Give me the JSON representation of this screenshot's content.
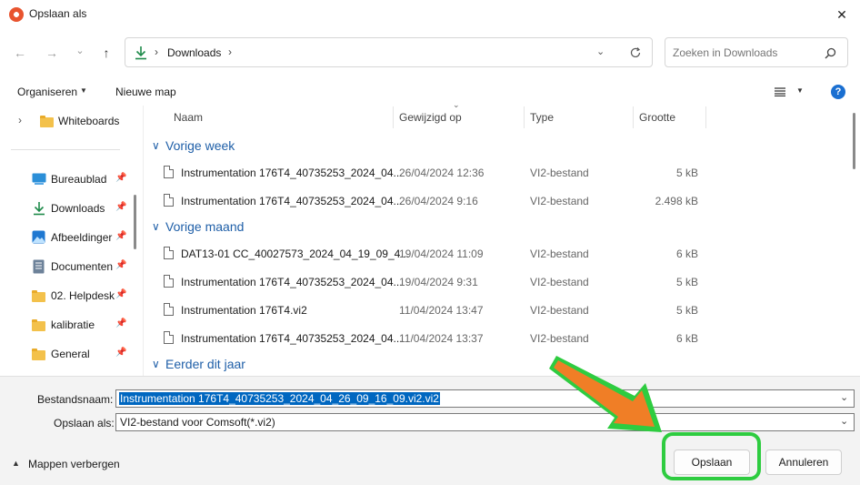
{
  "window": {
    "title": "Opslaan als",
    "close_label": "✕"
  },
  "nav": {
    "back": "←",
    "forward": "→",
    "recent": "⌄",
    "up": "↑",
    "breadcrumb": [
      "Downloads"
    ],
    "search_placeholder": "Zoeken in Downloads"
  },
  "toolbar": {
    "organize": "Organiseren",
    "new_folder": "Nieuwe map"
  },
  "sidebar": {
    "tree_item": "Whiteboards",
    "items": [
      {
        "label": "Bureaublad",
        "icon": "desktop-icon"
      },
      {
        "label": "Downloads",
        "icon": "downloads-icon"
      },
      {
        "label": "Afbeeldinger",
        "icon": "pictures-icon"
      },
      {
        "label": "Documenten",
        "icon": "documents-icon"
      },
      {
        "label": "02. Helpdesk",
        "icon": "folder-icon"
      },
      {
        "label": "kalibratie",
        "icon": "folder-icon"
      },
      {
        "label": "General",
        "icon": "shared-folder-icon"
      }
    ]
  },
  "columns": {
    "name": "Naam",
    "modified": "Gewijzigd op",
    "type": "Type",
    "size": "Grootte"
  },
  "groups": [
    {
      "label": "Vorige week",
      "files": [
        {
          "name": "Instrumentation 176T4_40735253_2024_04...",
          "date": "26/04/2024 12:36",
          "type": "VI2-bestand",
          "size": "5 kB"
        },
        {
          "name": "Instrumentation 176T4_40735253_2024_04...",
          "date": "26/04/2024 9:16",
          "type": "VI2-bestand",
          "size": "2.498 kB"
        }
      ]
    },
    {
      "label": "Vorige maand",
      "files": [
        {
          "name": "DAT13-01 CC_40027573_2024_04_19_09_4...",
          "date": "19/04/2024 11:09",
          "type": "VI2-bestand",
          "size": "6 kB"
        },
        {
          "name": "Instrumentation 176T4_40735253_2024_04...",
          "date": "19/04/2024 9:31",
          "type": "VI2-bestand",
          "size": "5 kB"
        },
        {
          "name": "Instrumentation 176T4.vi2",
          "date": "11/04/2024 13:47",
          "type": "VI2-bestand",
          "size": "5 kB"
        },
        {
          "name": "Instrumentation 176T4_40735253_2024_04...",
          "date": "11/04/2024 13:37",
          "type": "VI2-bestand",
          "size": "6 kB"
        }
      ]
    },
    {
      "label": "Eerder dit jaar",
      "files": []
    }
  ],
  "form": {
    "filename_label": "Bestandsnaam:",
    "filename_value": "Instrumentation 176T4_40735253_2024_04_26_09_16_09.vi2.vi2",
    "filetype_label": "Opslaan als:",
    "filetype_value": "VI2-bestand voor Comsoft(*.vi2)"
  },
  "footer": {
    "hide_folders": "Mappen verbergen",
    "save": "Opslaan",
    "cancel": "Annuleren"
  },
  "colors": {
    "accent": "#0067c0",
    "highlight_ring": "#2ecc40",
    "arrow": "#f07e26"
  }
}
